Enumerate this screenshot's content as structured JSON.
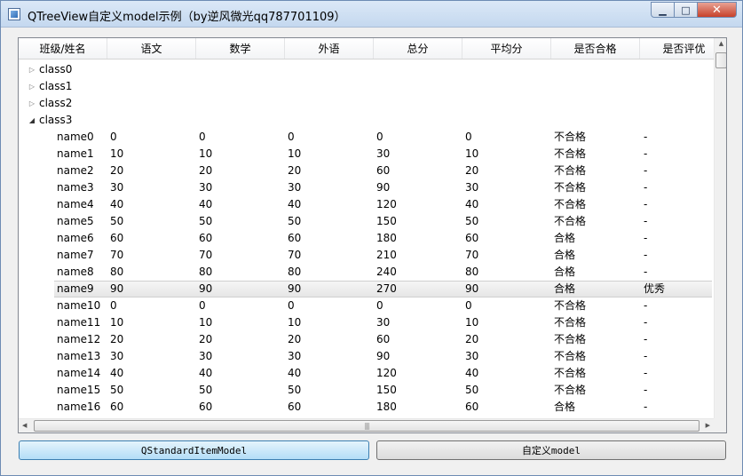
{
  "window": {
    "title": "QTreeView自定义model示例（by逆风微光qq787701109）",
    "buttons": {
      "minimize": "▁",
      "maximize": "□",
      "close": "✕"
    }
  },
  "tree": {
    "columns": [
      "班级/姓名",
      "语文",
      "数学",
      "外语",
      "总分",
      "平均分",
      "是否合格",
      "是否评优"
    ],
    "classes": [
      {
        "label": "class0",
        "expanded": false
      },
      {
        "label": "class1",
        "expanded": false
      },
      {
        "label": "class2",
        "expanded": false
      },
      {
        "label": "class3",
        "expanded": true
      }
    ],
    "students": [
      [
        "name0",
        "0",
        "0",
        "0",
        "0",
        "0",
        "不合格",
        "-"
      ],
      [
        "name1",
        "10",
        "10",
        "10",
        "30",
        "10",
        "不合格",
        "-"
      ],
      [
        "name2",
        "20",
        "20",
        "20",
        "60",
        "20",
        "不合格",
        "-"
      ],
      [
        "name3",
        "30",
        "30",
        "30",
        "90",
        "30",
        "不合格",
        "-"
      ],
      [
        "name4",
        "40",
        "40",
        "40",
        "120",
        "40",
        "不合格",
        "-"
      ],
      [
        "name5",
        "50",
        "50",
        "50",
        "150",
        "50",
        "不合格",
        "-"
      ],
      [
        "name6",
        "60",
        "60",
        "60",
        "180",
        "60",
        "合格",
        "-"
      ],
      [
        "name7",
        "70",
        "70",
        "70",
        "210",
        "70",
        "合格",
        "-"
      ],
      [
        "name8",
        "80",
        "80",
        "80",
        "240",
        "80",
        "合格",
        "-"
      ],
      [
        "name9",
        "90",
        "90",
        "90",
        "270",
        "90",
        "合格",
        "优秀"
      ],
      [
        "name10",
        "0",
        "0",
        "0",
        "0",
        "0",
        "不合格",
        "-"
      ],
      [
        "name11",
        "10",
        "10",
        "10",
        "30",
        "10",
        "不合格",
        "-"
      ],
      [
        "name12",
        "20",
        "20",
        "20",
        "60",
        "20",
        "不合格",
        "-"
      ],
      [
        "name13",
        "30",
        "30",
        "30",
        "90",
        "30",
        "不合格",
        "-"
      ],
      [
        "name14",
        "40",
        "40",
        "40",
        "120",
        "40",
        "不合格",
        "-"
      ],
      [
        "name15",
        "50",
        "50",
        "50",
        "150",
        "50",
        "不合格",
        "-"
      ],
      [
        "name16",
        "60",
        "60",
        "60",
        "180",
        "60",
        "合格",
        "-"
      ]
    ],
    "selected_student": "name9"
  },
  "icons": {
    "collapsed": "▷",
    "expanded": "◢",
    "scroll_up": "▲",
    "scroll_left": "◀",
    "scroll_right": "▶",
    "grip": "|||"
  },
  "buttons": {
    "standard_model": "QStandardItemModel",
    "custom_model": "自定义model"
  }
}
